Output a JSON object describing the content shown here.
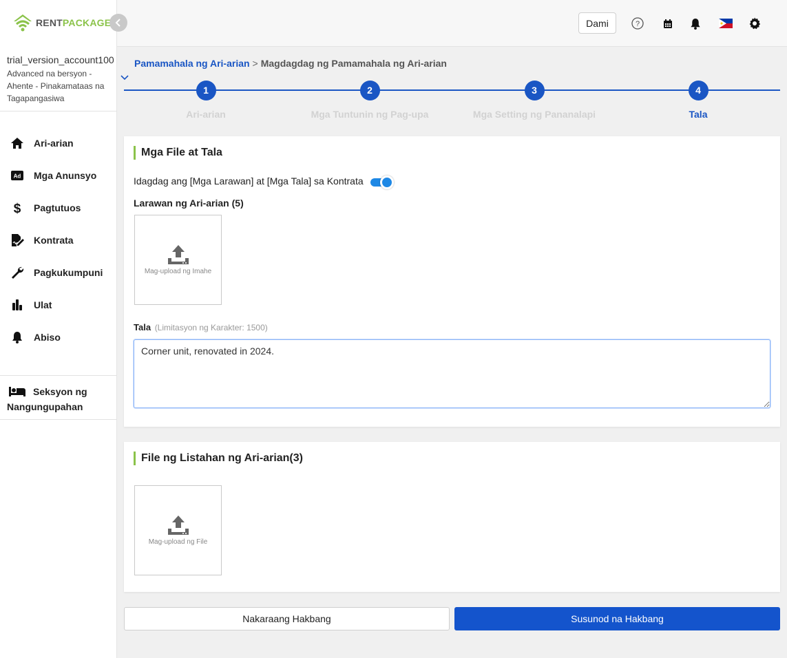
{
  "logo": {
    "brand_rent": "RENT",
    "brand_package": "PACKAGE",
    "color_green": "#8bc34a"
  },
  "account": {
    "name": "trial_version_account100",
    "plan": "Advanced na bersyon - Ahente - Pinakamataas na Tagapangasiwa"
  },
  "sidebar": {
    "items": [
      {
        "label": "Ari-arian",
        "icon": "home-icon"
      },
      {
        "label": "Mga Anunsyo",
        "icon": "ad-icon"
      },
      {
        "label": "Pagtutuos",
        "icon": "dollar-icon"
      },
      {
        "label": "Kontrata",
        "icon": "contract-icon"
      },
      {
        "label": "Pagkukumpuni",
        "icon": "wrench-icon"
      },
      {
        "label": "Ulat",
        "icon": "bar-chart-icon"
      },
      {
        "label": "Abiso",
        "icon": "bell-icon"
      }
    ],
    "tenant_section": "Seksyon ng Nangungupahan"
  },
  "header": {
    "more_label": "Dami",
    "icons": [
      "help-icon",
      "calendar-icon",
      "bell-icon",
      "philippines-flag-icon",
      "gear-icon"
    ]
  },
  "breadcrumb": {
    "link": "Pamamahala ng Ari-arian",
    "separator": ">",
    "current": "Magdagdag ng Pamamahala ng Ari-arian"
  },
  "steps": [
    {
      "number": "1",
      "label": "Ari-arian",
      "active": false
    },
    {
      "number": "2",
      "label": "Mga Tuntunin ng Pag-upa",
      "active": false
    },
    {
      "number": "3",
      "label": "Mga Setting ng Pananalapi",
      "active": true,
      "dimmed": true
    },
    {
      "number": "4",
      "label": "Tala",
      "active": true
    }
  ],
  "files_card": {
    "title": "Mga File at Tala",
    "toggle_label": "Idagdag ang [Mga Larawan] at [Mga Tala] sa Kontrata",
    "toggle_on": true,
    "images_label": "Larawan ng Ari-arian (5)",
    "upload_image_label": "Mag-upload ng Imahe",
    "note_label": "Tala",
    "note_limit": "(Limitasyon ng Karakter: 1500)",
    "note_value": "Corner unit, renovated in 2024."
  },
  "listing_card": {
    "title": "File ng Listahan ng Ari-arian(3)",
    "upload_file_label": "Mag-upload ng File"
  },
  "footer": {
    "prev_label": "Nakaraang Hakbang",
    "next_label": "Susunod na Hakbang"
  },
  "colors": {
    "primary": "#1a56c4",
    "accent": "#8bc34a",
    "toggle": "#1e88e5"
  }
}
